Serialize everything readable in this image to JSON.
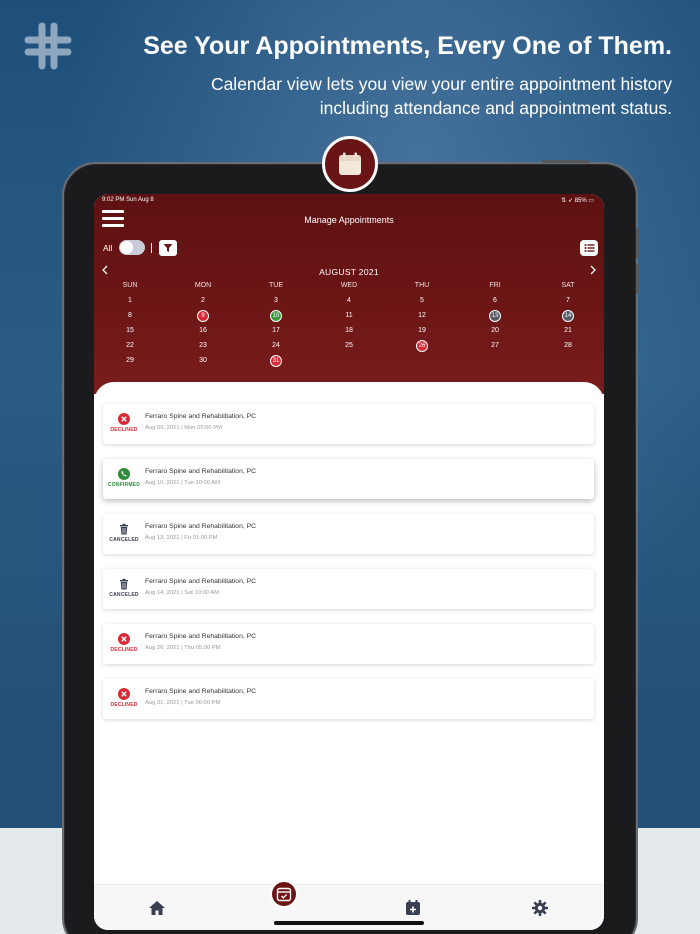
{
  "promo": {
    "headline": "See Your Appointments, Every One of Them.",
    "subline": "Calendar view lets you view your entire appointment history including attendance and appointment status."
  },
  "device": {
    "status_time": "9:02 PM  Sun Aug 8",
    "status_right": "⇅ ➶ 85% ▭",
    "title": "Manage Appointments"
  },
  "filter": {
    "all_label": "All",
    "toggle_on": false
  },
  "calendar": {
    "month": "AUGUST 2021",
    "prev_icon": "chevron-left-icon",
    "next_icon": "chevron-right-icon",
    "weekdays": [
      "SUN",
      "MON",
      "TUE",
      "WED",
      "THU",
      "FRI",
      "SAT"
    ],
    "weeks": [
      [
        "1",
        "2",
        "3",
        "4",
        "5",
        "6",
        "7"
      ],
      [
        "8",
        "9",
        "10",
        "11",
        "12",
        "13",
        "14"
      ],
      [
        "15",
        "16",
        "17",
        "18",
        "19",
        "20",
        "21"
      ],
      [
        "22",
        "23",
        "24",
        "25",
        "26",
        "27",
        "28"
      ],
      [
        "29",
        "30",
        "31",
        "",
        "",
        "",
        ""
      ]
    ],
    "highlights": {
      "9": "red",
      "10": "green",
      "13": "gray",
      "14": "gray",
      "26": "red",
      "31": "red"
    }
  },
  "appointments": [
    {
      "status": "DECLINED",
      "icon": "x-circle-icon",
      "color": "#d62b36",
      "clinic": "Ferraro Spine and Rehabilitation, PC",
      "when": "Aug 09, 2021 | Mon 05:00 PM"
    },
    {
      "status": "CONFIRMED",
      "icon": "phone-icon",
      "color": "#2e8b3a",
      "clinic": "Ferraro Spine and Rehabilitation, PC",
      "when": "Aug 10, 2021 | Tue 10:00 AM"
    },
    {
      "status": "CANCELED",
      "icon": "trash-icon",
      "color": "#3a3f52",
      "clinic": "Ferraro Spine and Rehabilitation, PC",
      "when": "Aug 13, 2021 | Fri 01:00 PM"
    },
    {
      "status": "CANCELED",
      "icon": "trash-icon",
      "color": "#3a3f52",
      "clinic": "Ferraro Spine and Rehabilitation, PC",
      "when": "Aug 14, 2021 | Sat 10:00 AM"
    },
    {
      "status": "DECLINED",
      "icon": "x-circle-icon",
      "color": "#d62b36",
      "clinic": "Ferraro Spine and Rehabilitation, PC",
      "when": "Aug 26, 2021 | Thu 05:00 PM"
    },
    {
      "status": "DECLINED",
      "icon": "x-circle-icon",
      "color": "#d62b36",
      "clinic": "Ferraro Spine and Rehabilitation, PC",
      "when": "Aug 31, 2021 | Tue 06:00 PM"
    }
  ],
  "colors": {
    "brand": "#6b1515",
    "declined": "#d62b36",
    "confirmed": "#2e8b3a",
    "canceled": "#3a3f52"
  },
  "tabs": [
    {
      "name": "home",
      "icon": "home-icon"
    },
    {
      "name": "appointments",
      "icon": "calendar-check-icon",
      "active": true
    },
    {
      "name": "add-appointment",
      "icon": "calendar-plus-icon"
    },
    {
      "name": "settings",
      "icon": "gear-icon"
    }
  ]
}
